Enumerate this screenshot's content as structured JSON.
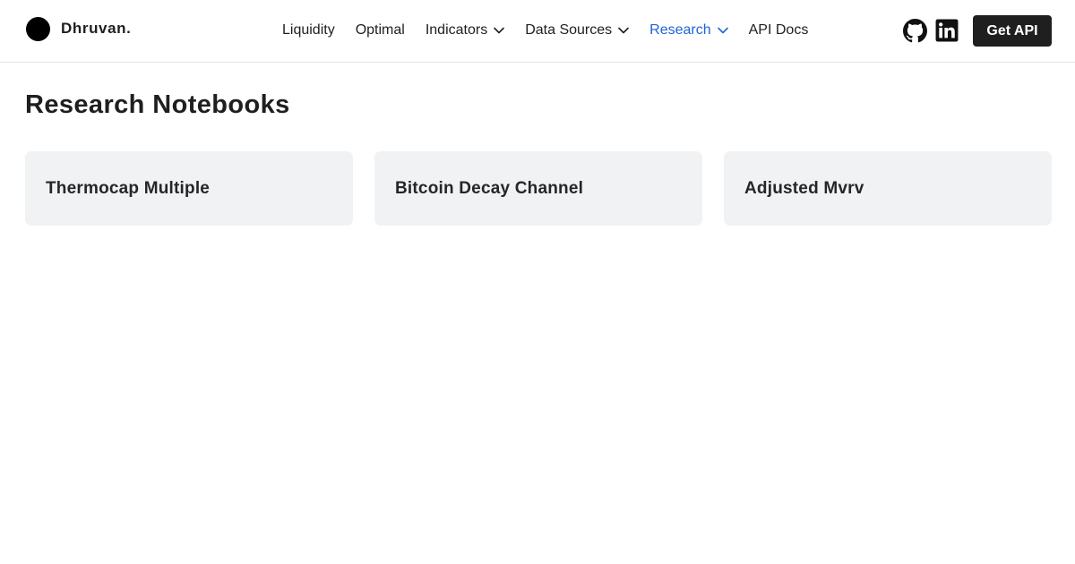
{
  "brand": {
    "name": "Dhruvan."
  },
  "nav": {
    "items": [
      {
        "label": "Liquidity"
      },
      {
        "label": "Optimal"
      },
      {
        "label": "Indicators"
      },
      {
        "label": "Data Sources"
      },
      {
        "label": "Research"
      },
      {
        "label": "API Docs"
      }
    ],
    "active_item": "Research"
  },
  "header": {
    "cta_label": "Get API",
    "icons": [
      "github-icon",
      "linkedin-icon"
    ]
  },
  "main": {
    "title": "Research Notebooks",
    "cards": [
      {
        "title": "Thermocap Multiple"
      },
      {
        "title": "Bitcoin Decay Channel"
      },
      {
        "title": "Adjusted Mvrv"
      }
    ]
  },
  "colors": {
    "accent": "#1e63d6",
    "text": "#1f1f1f",
    "card_bg": "#f1f2f4",
    "button_bg": "#1f1f1f"
  }
}
